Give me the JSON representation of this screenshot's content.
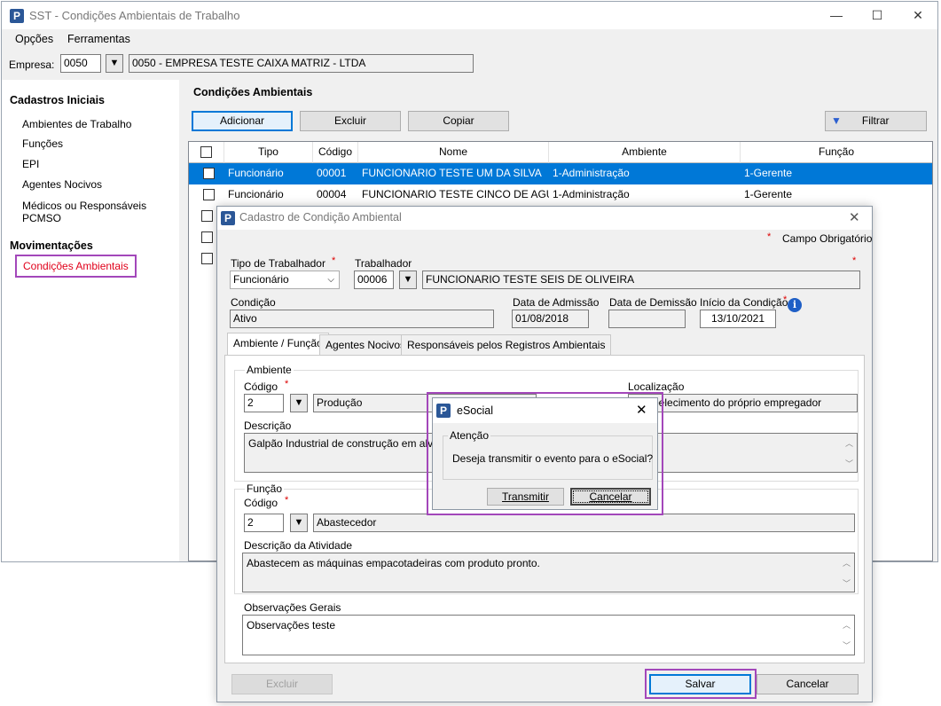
{
  "main_window": {
    "title": "SST - Condições Ambientais de Trabalho",
    "app_icon_letter": "P",
    "controls": {
      "minimize": "—",
      "maximize": "☐",
      "close": "✕"
    },
    "menu": [
      "Opções",
      "Ferramentas"
    ],
    "empresa": {
      "label": "Empresa:",
      "code": "0050",
      "name": "0050 - EMPRESA TESTE CAIXA MATRIZ -  LTDA"
    },
    "sidebar": {
      "section1_title": "Cadastros Iniciais",
      "items": [
        "Ambientes de Trabalho",
        "Funções",
        "EPI",
        "Agentes Nocivos",
        "Médicos ou Responsáveis PCMSO"
      ],
      "section2_title": "Movimentações",
      "active_item": "Condições Ambientais"
    },
    "content_title": "Condições Ambientais",
    "buttons": {
      "add": "Adicionar",
      "delete": "Excluir",
      "copy": "Copiar",
      "filter": "Filtrar"
    },
    "grid": {
      "columns": [
        "Tipo",
        "Código",
        "Nome",
        "Ambiente",
        "Função"
      ],
      "rows": [
        {
          "tipo": "Funcionário",
          "codigo": "00001",
          "nome": "FUNCIONARIO TESTE UM DA SILVA",
          "ambiente": "1-Administração",
          "funcao": "1-Gerente",
          "selected": true
        },
        {
          "tipo": "Funcionário",
          "codigo": "00004",
          "nome": "FUNCIONARIO TESTE CINCO DE AGUIA...",
          "ambiente": "1-Administração",
          "funcao": "1-Gerente",
          "selected": false
        }
      ]
    }
  },
  "cadastro_dialog": {
    "title": "Cadastro de Condição Ambiental",
    "required_note": "Campo Obrigatório",
    "required_mark": "*",
    "tipo_trabalhador": {
      "label": "Tipo de Trabalhador",
      "value": "Funcionário"
    },
    "trabalhador": {
      "label": "Trabalhador",
      "code": "00006",
      "name": "FUNCIONARIO TESTE SEIS DE OLIVEIRA"
    },
    "condicao": {
      "label": "Condição",
      "value": "Ativo"
    },
    "data_admissao": {
      "label": "Data de Admissão",
      "value": "01/08/2018"
    },
    "data_demissao": {
      "label": "Data de Demissão",
      "value": ""
    },
    "inicio_condicao": {
      "label": "Início da Condição",
      "value": "13/10/2021"
    },
    "tabs": [
      "Ambiente / Função",
      "Agentes Nocivos",
      "Responsáveis pelos Registros Ambientais"
    ],
    "ambiente": {
      "group_label": "Ambiente",
      "codigo_label": "Código",
      "codigo": "2",
      "nome": "Produção",
      "localizacao_label": "Localização",
      "localizacao": "Estabelecimento do próprio empregador",
      "descricao_label": "Descrição",
      "descricao": "Galpão Industrial de construção em alvenaria"
    },
    "funcao": {
      "group_label": "Função",
      "codigo_label": "Código",
      "codigo": "2",
      "nome": "Abastecedor",
      "descricao_atividade_label": "Descrição da Atividade",
      "descricao_atividade": "Abastecem as máquinas empacotadeiras com produto pronto."
    },
    "observacoes": {
      "label": "Observações Gerais",
      "value": "Observações teste"
    },
    "buttons": {
      "delete": "Excluir",
      "save": "Salvar",
      "cancel": "Cancelar"
    }
  },
  "esocial_dialog": {
    "title": "eSocial",
    "group_label": "Atenção",
    "message": "Deseja transmitir o evento para o eSocial?",
    "buttons": {
      "transmit": "Transmitir",
      "cancel": "Cancelar"
    }
  },
  "colors": {
    "accent": "#0078d7",
    "highlight": "#a347ba",
    "required": "#d00000"
  }
}
